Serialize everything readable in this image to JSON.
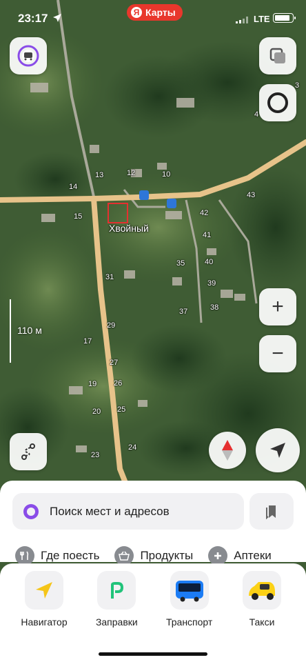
{
  "status_bar": {
    "time": "23:17",
    "network": "LTE",
    "app_badge": {
      "letter": "Я",
      "name": "Карты",
      "color": "#e8372c"
    }
  },
  "map": {
    "place_name": "Хвойный",
    "house_numbers": [
      "13",
      "12",
      "10",
      "14",
      "43",
      "15",
      "42",
      "41",
      "40",
      "35",
      "39",
      "31",
      "38",
      "37",
      "29",
      "17",
      "27",
      "19",
      "26",
      "20",
      "25",
      "24",
      "23",
      "4",
      "3"
    ],
    "scale_label": "110 м",
    "road_color": "#e7c38a",
    "bus_stop_icon": "bus-stop-icon"
  },
  "controls": {
    "layers": "layers-icon",
    "menu": "profile-icon",
    "zoom_in": "+",
    "zoom_out": "−",
    "route": "route-icon",
    "compass": "compass-icon",
    "my_location": "location-arrow-icon"
  },
  "search": {
    "placeholder": "Поиск мест и адресов",
    "bookmarks_icon": "bookmarks-icon"
  },
  "categories": [
    {
      "icon": "fork-knife-icon",
      "label": "Где поесть"
    },
    {
      "icon": "basket-icon",
      "label": "Продукты"
    },
    {
      "icon": "pharmacy-cross-icon",
      "label": "Аптеки"
    }
  ],
  "services": [
    {
      "icon": "navigator-icon",
      "label": "Навигатор",
      "color": "#f5c518"
    },
    {
      "icon": "fuel-icon",
      "label": "Заправки",
      "color": "#21c37a"
    },
    {
      "icon": "bus-icon",
      "label": "Транспорт",
      "color": "#1c7cf4"
    },
    {
      "icon": "taxi-icon",
      "label": "Такси",
      "color": "#fcd116"
    }
  ]
}
